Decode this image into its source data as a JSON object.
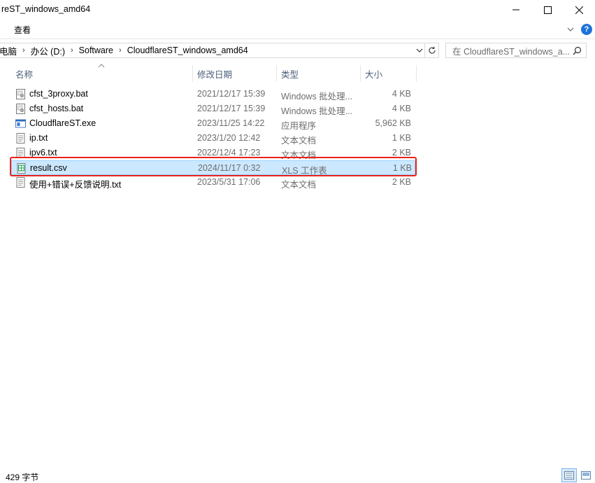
{
  "window": {
    "title": "reST_windows_amd64"
  },
  "ribbon": {
    "view_tab": "查看"
  },
  "address": {
    "crumbs": [
      "此电脑",
      "办公 (D:)",
      "Software",
      "CloudflareST_windows_amd64"
    ],
    "crumb_visible_first": "电脑"
  },
  "search": {
    "placeholder": "在 CloudflareST_windows_a..."
  },
  "columns": {
    "name": "名称",
    "date": "修改日期",
    "type": "类型",
    "size": "大小"
  },
  "files": [
    {
      "name": "cfst_3proxy.bat",
      "date": "2021/12/17 15:39",
      "type": "Windows 批处理...",
      "size": "4 KB",
      "icon": "batch-file-icon"
    },
    {
      "name": "cfst_hosts.bat",
      "date": "2021/12/17 15:39",
      "type": "Windows 批处理...",
      "size": "4 KB",
      "icon": "batch-file-icon"
    },
    {
      "name": "CloudflareST.exe",
      "date": "2023/11/25 14:22",
      "type": "应用程序",
      "size": "5,962 KB",
      "icon": "exe-file-icon"
    },
    {
      "name": "ip.txt",
      "date": "2023/1/20 12:42",
      "type": "文本文档",
      "size": "1 KB",
      "icon": "text-file-icon"
    },
    {
      "name": "ipv6.txt",
      "date": "2022/12/4 17:23",
      "type": "文本文档",
      "size": "2 KB",
      "icon": "text-file-icon"
    },
    {
      "name": "result.csv",
      "date": "2024/11/17 0:32",
      "type": "XLS 工作表",
      "size": "1 KB",
      "icon": "csv-file-icon",
      "selected": true
    },
    {
      "name": "使用+错误+反馈说明.txt",
      "date": "2023/5/31 17:06",
      "type": "文本文档",
      "size": "2 KB",
      "icon": "text-file-icon"
    }
  ],
  "status": {
    "text": "429 字节"
  },
  "colors": {
    "selection": "#cce8ff",
    "highlight_border": "#e8231b",
    "header_text": "#4c607a"
  }
}
